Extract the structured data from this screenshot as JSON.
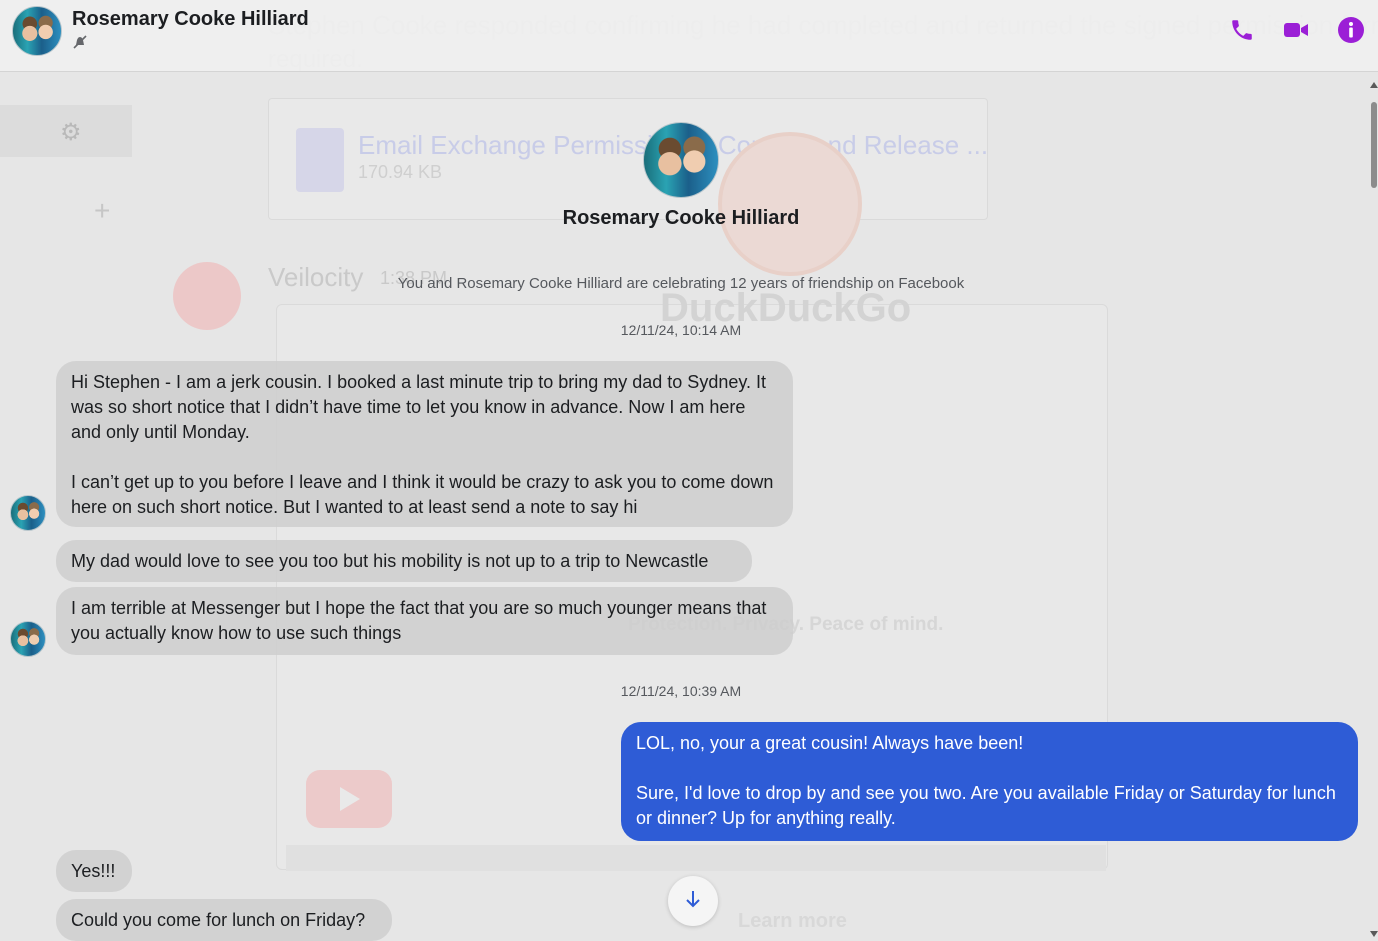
{
  "header": {
    "name": "Rosemary Cooke Hilliard",
    "status_icon": "muted-bell-icon",
    "actions": {
      "call_icon": "phone-icon",
      "video_icon": "video-camera-icon",
      "info_icon": "info-icon"
    },
    "accent_color": "#9b1fd6"
  },
  "background_ghost": {
    "line1": "Stephen Cooke responded confirming he had completed and returned the signed permission form",
    "line2": "required.",
    "attachment_name": "Email Exchange Permission to Consult and Release ...",
    "attachment_size": "170.94 KB",
    "channel_name": "Veilocity",
    "channel_time": "1:38 PM",
    "browser_brand": "DuckDuckGo",
    "tagline": "Protection. Privacy. Peace of mind.",
    "learn_more": "Learn more"
  },
  "conversation": {
    "profile_name": "Rosemary Cooke Hilliard",
    "friendship_note": "You and Rosemary Cooke Hilliard are celebrating 12 years of friendship on Facebook",
    "timestamp_1": "12/11/24, 10:14 AM",
    "timestamp_2": "12/11/24, 10:39 AM",
    "messages": [
      {
        "direction": "incoming",
        "text": "Hi Stephen - I am a jerk cousin. I booked a last minute trip to bring my dad to Sydney. It was so short notice that I didn’t have time to let you know in advance. Now I am here and only until Monday.\n\nI can’t get up to you before I leave and I think it would be crazy to ask you to come down here on such short notice. But I wanted to at least send a note to say hi"
      },
      {
        "direction": "incoming",
        "text": "My dad would love to see you too but his mobility is not up to a trip to Newcastle"
      },
      {
        "direction": "incoming",
        "text": "I am terrible at Messenger but I hope the fact that you are so much younger means that you actually know how to use such things"
      },
      {
        "direction": "outgoing",
        "text": "LOL, no, your a great cousin! Always have been!\n\nSure, I'd love to drop by and see you two. Are you available Friday or Saturday for lunch or dinner? Up for anything really."
      },
      {
        "direction": "incoming",
        "text": "Yes!!!"
      },
      {
        "direction": "incoming",
        "text": "Could you come for lunch on Friday?"
      }
    ],
    "scroll_down_icon": "arrow-down-icon",
    "outgoing_color": "#2e5cd6"
  }
}
